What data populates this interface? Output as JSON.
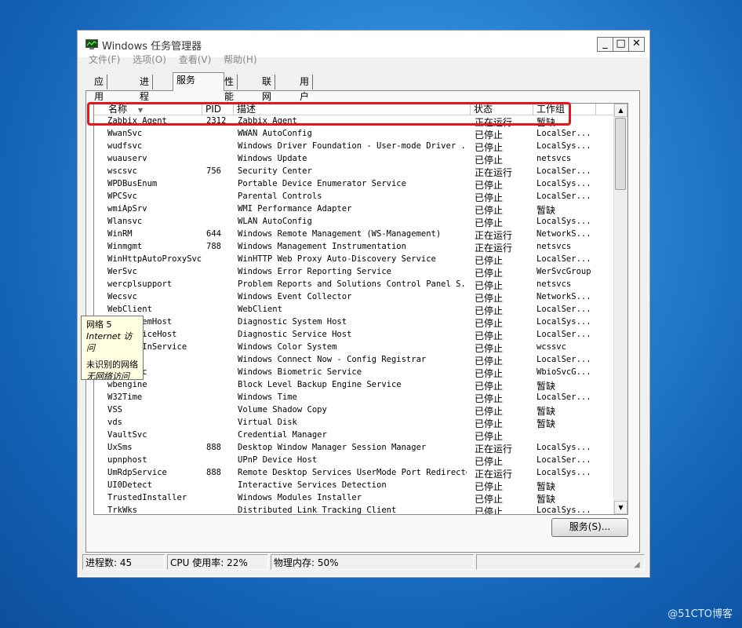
{
  "window": {
    "title": "Windows 任务管理器",
    "min_label": "_",
    "max_label": "□",
    "close_label": "✕"
  },
  "menu": [
    "文件(F)",
    "选项(O)",
    "查看(V)",
    "帮助(H)"
  ],
  "tabs": [
    "应用程序",
    "进程",
    "服务",
    "性能",
    "联网",
    "用户"
  ],
  "active_tab": "服务",
  "columns": {
    "name": "名称",
    "pid": "PID",
    "desc": "描述",
    "status": "状态",
    "group": "工作组"
  },
  "rows": [
    {
      "name": "Zabbix Agent",
      "pid": "2312",
      "desc": "Zabbix Agent",
      "status": "正在运行",
      "group": "暂缺"
    },
    {
      "name": "WwanSvc",
      "pid": "",
      "desc": "WWAN AutoConfig",
      "status": "已停止",
      "group": "LocalSer..."
    },
    {
      "name": "wudfsvc",
      "pid": "",
      "desc": "Windows Driver Foundation - User-mode Driver ...",
      "status": "已停止",
      "group": "LocalSys..."
    },
    {
      "name": "wuauserv",
      "pid": "",
      "desc": "Windows Update",
      "status": "已停止",
      "group": "netsvcs"
    },
    {
      "name": "wscsvc",
      "pid": "756",
      "desc": "Security Center",
      "status": "正在运行",
      "group": "LocalSer..."
    },
    {
      "name": "WPDBusEnum",
      "pid": "",
      "desc": "Portable Device Enumerator Service",
      "status": "已停止",
      "group": "LocalSys..."
    },
    {
      "name": "WPCSvc",
      "pid": "",
      "desc": "Parental Controls",
      "status": "已停止",
      "group": "LocalSer..."
    },
    {
      "name": "wmiApSrv",
      "pid": "",
      "desc": "WMI Performance Adapter",
      "status": "已停止",
      "group": "暂缺"
    },
    {
      "name": "Wlansvc",
      "pid": "",
      "desc": "WLAN AutoConfig",
      "status": "已停止",
      "group": "LocalSys..."
    },
    {
      "name": "WinRM",
      "pid": "644",
      "desc": "Windows Remote Management (WS-Management)",
      "status": "正在运行",
      "group": "NetworkS..."
    },
    {
      "name": "Winmgmt",
      "pid": "788",
      "desc": "Windows Management Instrumentation",
      "status": "正在运行",
      "group": "netsvcs"
    },
    {
      "name": "WinHttpAutoProxySvc",
      "pid": "",
      "desc": "WinHTTP Web Proxy Auto-Discovery Service",
      "status": "已停止",
      "group": "LocalSer..."
    },
    {
      "name": "WerSvc",
      "pid": "",
      "desc": "Windows Error Reporting Service",
      "status": "已停止",
      "group": "WerSvcGroup"
    },
    {
      "name": "wercplsupport",
      "pid": "",
      "desc": "Problem Reports and Solutions Control Panel S...",
      "status": "已停止",
      "group": "netsvcs"
    },
    {
      "name": "Wecsvc",
      "pid": "",
      "desc": "Windows Event Collector",
      "status": "已停止",
      "group": "NetworkS..."
    },
    {
      "name": "WebClient",
      "pid": "",
      "desc": "WebClient",
      "status": "已停止",
      "group": "LocalSer..."
    },
    {
      "name": "WdiSystemHost",
      "pid": "",
      "desc": "Diagnostic System Host",
      "status": "已停止",
      "group": "LocalSys..."
    },
    {
      "name": "WdiServiceHost",
      "pid": "",
      "desc": "Diagnostic Service Host",
      "status": "已停止",
      "group": "LocalSer..."
    },
    {
      "name": "WcsPlugInService",
      "pid": "",
      "desc": "Windows Color System",
      "status": "已停止",
      "group": "wcssvc"
    },
    {
      "name": "wcncsvc",
      "pid": "",
      "desc": "Windows Connect Now - Config Registrar",
      "status": "已停止",
      "group": "LocalSer..."
    },
    {
      "name": "WbioSrvc",
      "pid": "",
      "desc": "Windows Biometric Service",
      "status": "已停止",
      "group": "WbioSvcG..."
    },
    {
      "name": "wbengine",
      "pid": "",
      "desc": "Block Level Backup Engine Service",
      "status": "已停止",
      "group": "暂缺"
    },
    {
      "name": "W32Time",
      "pid": "",
      "desc": "Windows Time",
      "status": "已停止",
      "group": "LocalSer..."
    },
    {
      "name": "VSS",
      "pid": "",
      "desc": "Volume Shadow Copy",
      "status": "已停止",
      "group": "暂缺"
    },
    {
      "name": "vds",
      "pid": "",
      "desc": "Virtual Disk",
      "status": "已停止",
      "group": "暂缺"
    },
    {
      "name": "VaultSvc",
      "pid": "",
      "desc": "Credential Manager",
      "status": "已停止",
      "group": ""
    },
    {
      "name": "UxSms",
      "pid": "888",
      "desc": "Desktop Window Manager Session Manager",
      "status": "正在运行",
      "group": "LocalSys..."
    },
    {
      "name": "upnphost",
      "pid": "",
      "desc": "UPnP Device Host",
      "status": "已停止",
      "group": "LocalSer..."
    },
    {
      "name": "UmRdpService",
      "pid": "888",
      "desc": "Remote Desktop Services UserMode Port Redirector",
      "status": "正在运行",
      "group": "LocalSys..."
    },
    {
      "name": "UI0Detect",
      "pid": "",
      "desc": "Interactive Services Detection",
      "status": "已停止",
      "group": "暂缺"
    },
    {
      "name": "TrustedInstaller",
      "pid": "",
      "desc": "Windows Modules Installer",
      "status": "已停止",
      "group": "暂缺"
    },
    {
      "name": "TrkWks",
      "pid": "",
      "desc": "Distributed Link Tracking Client",
      "status": "已停止",
      "group": "LocalSys..."
    }
  ],
  "services_button": "服务(S)...",
  "status_bar": {
    "processes": "进程数: 45",
    "cpu": "CPU 使用率: 22%",
    "memory": "物理内存: 50%"
  },
  "tooltip": {
    "line1": "网络 5",
    "line2": "Internet 访问",
    "line3": "未识别的网络",
    "line4": "无网络访问"
  },
  "watermark": "@51CTO博客"
}
